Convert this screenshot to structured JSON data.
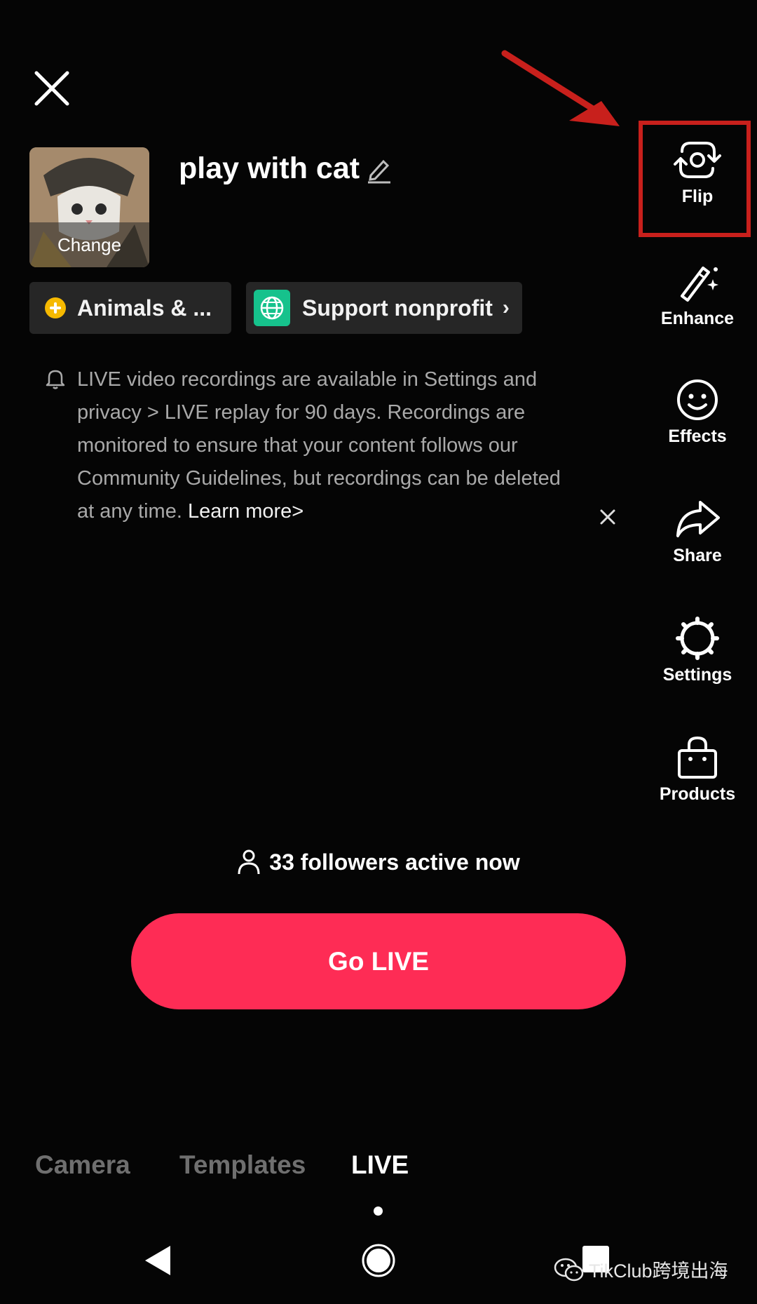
{
  "header": {
    "close_icon": "close-icon",
    "cover_change_label": "Change",
    "title": "play with cat",
    "edit_icon": "pencil-icon"
  },
  "chips": {
    "category_label": "Animals & ...",
    "nonprofit_label": "Support nonprofit",
    "nonprofit_chevron": "›"
  },
  "notice": {
    "text": "LIVE video recordings are available in Settings and privacy > LIVE replay for 90 days. Recordings are monitored to ensure that your content follows our Community Guidelines, but recordings can be deleted at any time. ",
    "learn_more": "Learn more>"
  },
  "rail": {
    "items": [
      {
        "label": "Flip",
        "icon": "flip-camera-icon"
      },
      {
        "label": "Enhance",
        "icon": "magic-wand-icon"
      },
      {
        "label": "Effects",
        "icon": "smiley-icon"
      },
      {
        "label": "Share",
        "icon": "share-arrow-icon"
      },
      {
        "label": "Settings",
        "icon": "gear-icon"
      },
      {
        "label": "Products",
        "icon": "shopping-bag-icon"
      }
    ]
  },
  "followers_text": "33 followers active now",
  "go_live_label": "Go LIVE",
  "tabs": {
    "camera": "Camera",
    "templates": "Templates",
    "live": "LIVE"
  },
  "watermark": "TikClub跨境出海",
  "colors": {
    "accent": "#fe2c55",
    "annotation_red": "#c8201c",
    "background": "#050505",
    "nonprofit_green": "#16c28c",
    "category_yellow": "#f6b900"
  }
}
